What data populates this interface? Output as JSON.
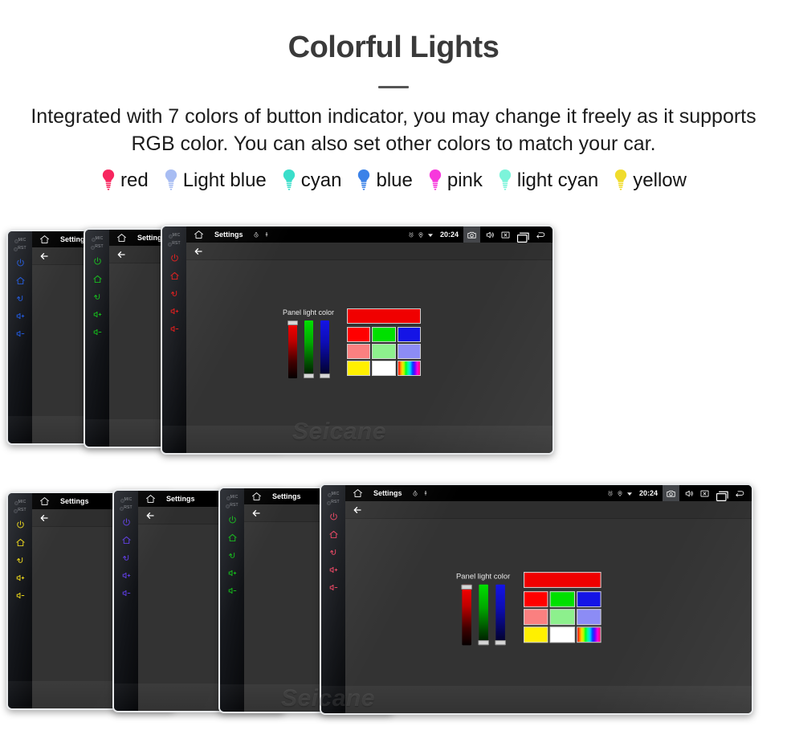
{
  "header": {
    "title": "Colorful Lights",
    "subtitle": "Integrated with 7 colors of button indicator, you may change it freely as it supports RGB color. You can also set other colors to match your car."
  },
  "legend": {
    "items": [
      {
        "label": "red",
        "color": "#F7265F",
        "icon": "bulb-icon"
      },
      {
        "label": "Light blue",
        "color": "#A8BDF3",
        "icon": "bulb-icon"
      },
      {
        "label": "cyan",
        "color": "#3ADECA",
        "icon": "bulb-icon"
      },
      {
        "label": "blue",
        "color": "#3B82E8",
        "icon": "bulb-icon"
      },
      {
        "label": "pink",
        "color": "#F738DC",
        "icon": "bulb-icon"
      },
      {
        "label": "light cyan",
        "color": "#7CF4DA",
        "icon": "bulb-icon"
      },
      {
        "label": "yellow",
        "color": "#F0DC2C",
        "icon": "bulb-icon"
      }
    ]
  },
  "device_ui": {
    "keystrip": {
      "mic_label": "MIC",
      "rst_label": "RST",
      "keys": [
        "power-icon",
        "home-icon",
        "back-icon",
        "volume-up-icon",
        "volume-down-icon"
      ]
    },
    "statusbar": {
      "home_icon": "home-icon",
      "title": "Settings",
      "left_icons": [
        "timer-icon",
        "usb-icon"
      ],
      "status_icons": [
        "alarm-icon",
        "location-pin-icon",
        "wifi-icon"
      ],
      "time": "20:24",
      "buttons": [
        "camera-icon",
        "volume-icon",
        "close-box-icon",
        "recents-icon",
        "back-arrow-icon"
      ],
      "highlighted_button": "camera-icon"
    },
    "actionbar": {
      "back_icon": "back-arrow-icon"
    },
    "panel_light": {
      "label": "Panel light color",
      "sliders": [
        {
          "channel": "R",
          "value": 255,
          "thumb": "top"
        },
        {
          "channel": "G",
          "value": 0,
          "thumb": "bottom"
        },
        {
          "channel": "B",
          "value": 0,
          "thumb": "bottom"
        }
      ],
      "preview_color": "#F00000",
      "swatches": [
        "#FF0000",
        "#00E000",
        "#1414E6",
        "#FA8080",
        "#8DF08D",
        "#8C8CF5",
        "#FFF000",
        "#FFFFFF",
        "rainbow"
      ]
    }
  },
  "watermark": {
    "text": "Seicane"
  },
  "groups": {
    "top": {
      "devices": [
        {
          "key_color": "#1E56D8",
          "full_ui": false
        },
        {
          "key_color": "#11B818",
          "full_ui": false
        },
        {
          "key_color": "#E01616",
          "full_ui": true
        }
      ]
    },
    "bottom": {
      "devices": [
        {
          "key_color": "#E8D318",
          "full_ui": false
        },
        {
          "key_color": "#5C3BE0",
          "full_ui": false
        },
        {
          "key_color": "#11B818",
          "full_ui": false
        },
        {
          "key_color": "#E8405E",
          "full_ui": true
        }
      ]
    }
  }
}
